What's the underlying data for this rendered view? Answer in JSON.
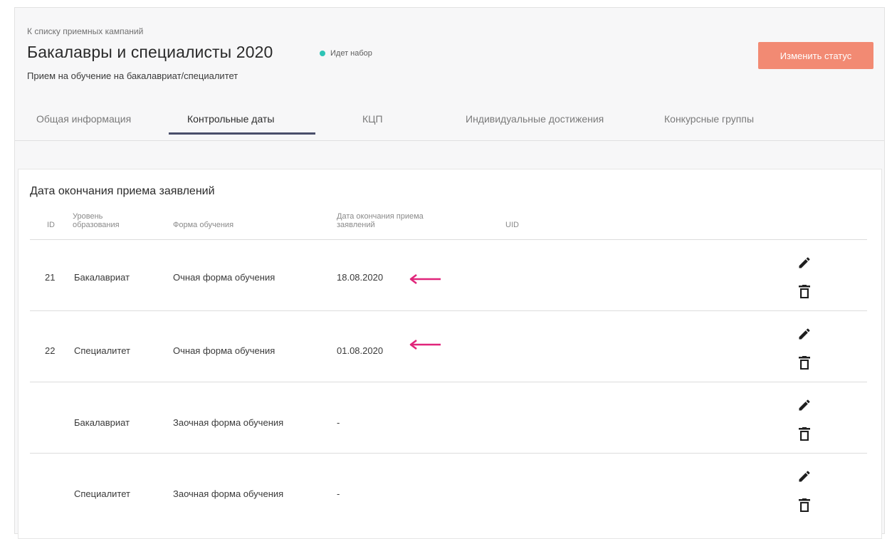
{
  "header": {
    "back_link": "К списку приемных кампаний",
    "title": "Бакалавры и специалисты 2020",
    "status": "Идет набор",
    "subtitle": "Прием на обучение на бакалавриат/специалитет",
    "change_status_label": "Изменить статус"
  },
  "tabs": [
    {
      "label": "Общая информация",
      "active": false
    },
    {
      "label": "Контрольные даты",
      "active": true
    },
    {
      "label": "КЦП",
      "active": false
    },
    {
      "label": "Индивидуальные достижения",
      "active": false
    },
    {
      "label": "Конкурсные группы",
      "active": false
    }
  ],
  "section": {
    "title": "Дата окончания приема заявлений",
    "columns": {
      "id": "ID",
      "level": [
        "Уровень",
        "образования"
      ],
      "form": "Форма обучения",
      "date": [
        "Дата окончания приема",
        "заявлений"
      ],
      "uid": "UID"
    },
    "rows": [
      {
        "id": "21",
        "level": "Бакалавриат",
        "form": "Очная форма обучения",
        "date": "18.08.2020",
        "uid": "",
        "arrow": true
      },
      {
        "id": "22",
        "level": "Специалитет",
        "form": "Очная форма обучения",
        "date": "01.08.2020",
        "uid": "",
        "arrow": true
      },
      {
        "id": "",
        "level": "Бакалавриат",
        "form": "Заочная форма обучения",
        "date": "-",
        "uid": "",
        "arrow": false
      },
      {
        "id": "",
        "level": "Специалитет",
        "form": "Заочная форма обучения",
        "date": "-",
        "uid": "",
        "arrow": false
      }
    ]
  },
  "colors": {
    "accent_button": "#f28a73",
    "status_dot": "#2ec4b6",
    "arrow": "#e0247a",
    "tab_underline": "#4a4f6b"
  },
  "icons": {
    "edit": "pencil-icon",
    "delete": "trash-icon",
    "annotation": "arrow-left-icon"
  }
}
